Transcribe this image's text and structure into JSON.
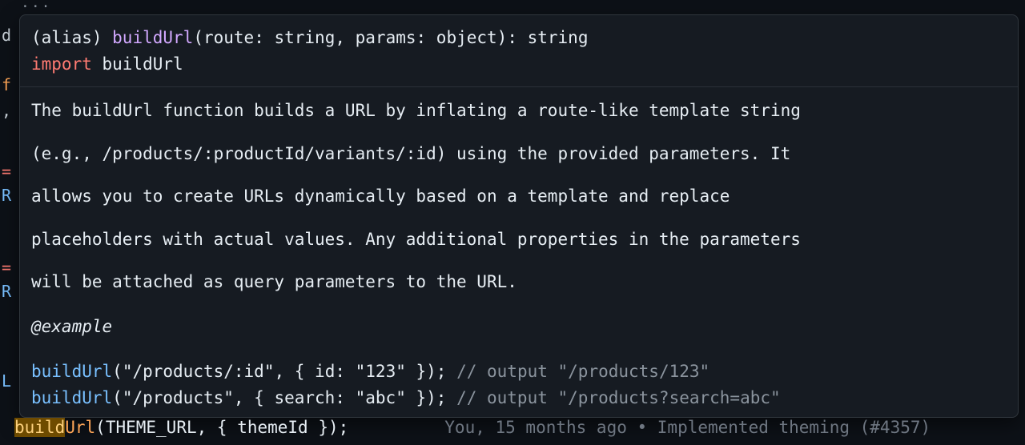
{
  "gutter": {
    "d": "d",
    "f": "f",
    "comma": ",",
    "eq1": "=",
    "R1": "R",
    "eq2": "=",
    "R2": "R",
    "L": "L"
  },
  "ellipsis": "···",
  "signature": {
    "alias_open": "(alias) ",
    "func": "buildUrl",
    "params_open": "(",
    "p1_name": "route",
    "colon1": ": ",
    "p1_type": "string",
    "sep": ", ",
    "p2_name": "params",
    "colon2": ": ",
    "p2_type": "object",
    "params_close": ")",
    "ret_colon": ": ",
    "ret_type": "string",
    "import_kw": "import",
    "import_name": " buildUrl"
  },
  "doc": {
    "l1": "The buildUrl function builds a URL by inflating a route-like template string",
    "l2": "(e.g., /products/:productId/variants/:id) using the provided parameters. It",
    "l3": "allows you to create URLs dynamically based on a template and replace",
    "l4": "placeholders with actual values. Any additional properties in the parameters",
    "l5": "will be attached as query parameters to the URL.",
    "example_tag": "@example"
  },
  "examples": {
    "e1_fn": "buildUrl",
    "e1_open": "(",
    "e1_s1": "\"/products/:id\"",
    "e1_sep": ", { ",
    "e1_key": "id",
    "e1_kv": ": ",
    "e1_s2": "\"123\"",
    "e1_close": " });",
    "e1_comment": " // output \"/products/123\"",
    "e2_fn": "buildUrl",
    "e2_open": "(",
    "e2_s1": "\"/products\"",
    "e2_sep": ", { ",
    "e2_key": "search",
    "e2_kv": ": ",
    "e2_s2": "\"abc\"",
    "e2_close": " });",
    "e2_comment": " // output \"/products?search=abc\""
  },
  "code_line": {
    "fn_hl": "build",
    "fn_rest": "Url",
    "open": "(",
    "arg1": "THEME_URL",
    "sep": ", { ",
    "arg2": "themeId",
    "close": " });"
  },
  "blame": {
    "text": "You, 15 months ago • Implemented theming (#4357)"
  }
}
